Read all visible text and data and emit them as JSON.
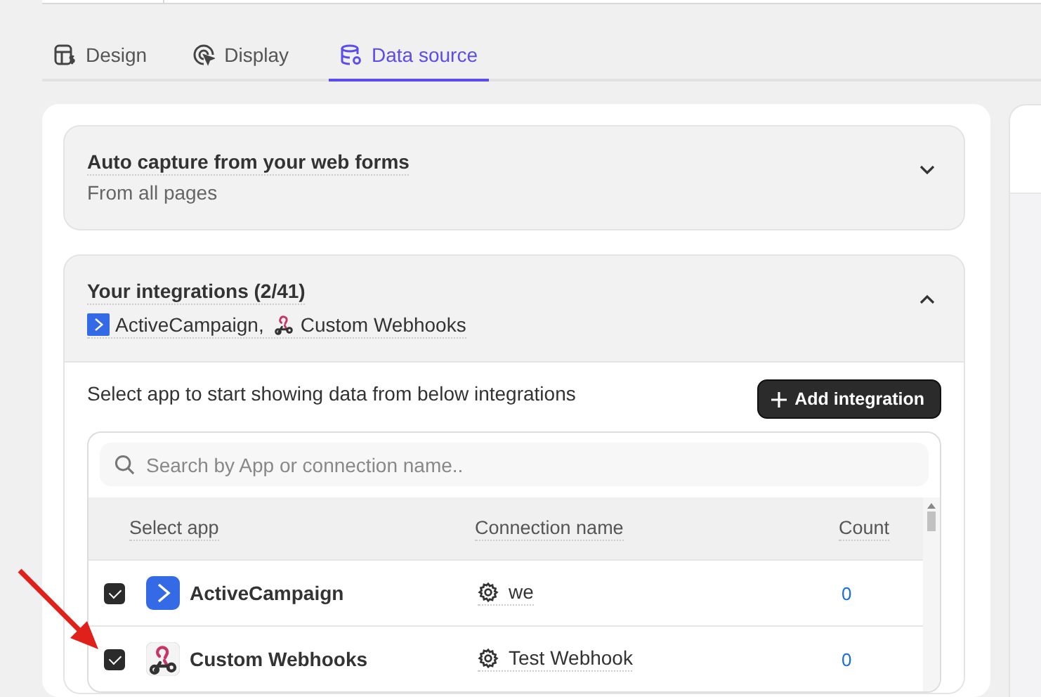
{
  "tabs": [
    {
      "label": "Design",
      "kind": "design",
      "selected": false
    },
    {
      "label": "Display",
      "kind": "display",
      "selected": false
    },
    {
      "label": "Data source",
      "kind": "data",
      "selected": true
    }
  ],
  "auto_capture": {
    "title": "Auto capture from your web forms",
    "subtitle": "From all pages",
    "expanded": false
  },
  "integrations": {
    "title": "Your integrations (2/41)",
    "expanded": true,
    "apps": [
      {
        "name": "ActiveCampaign,",
        "kind": "activecampaign"
      },
      {
        "name": "Custom Webhooks",
        "kind": "webhooks"
      }
    ],
    "hint": "Select app to start showing data from below integrations",
    "add_button": "Add integration",
    "search": {
      "placeholder": "Search by App or connection name.."
    },
    "columns": [
      "Select app",
      "Connection name",
      "Count"
    ],
    "rows": [
      {
        "app": "ActiveCampaign",
        "kind": "activecampaign",
        "connection": "we",
        "count": "0",
        "checked": true
      },
      {
        "app": "Custom Webhooks",
        "kind": "webhooks",
        "connection": "Test Webhook",
        "count": "0",
        "checked": true
      }
    ]
  }
}
